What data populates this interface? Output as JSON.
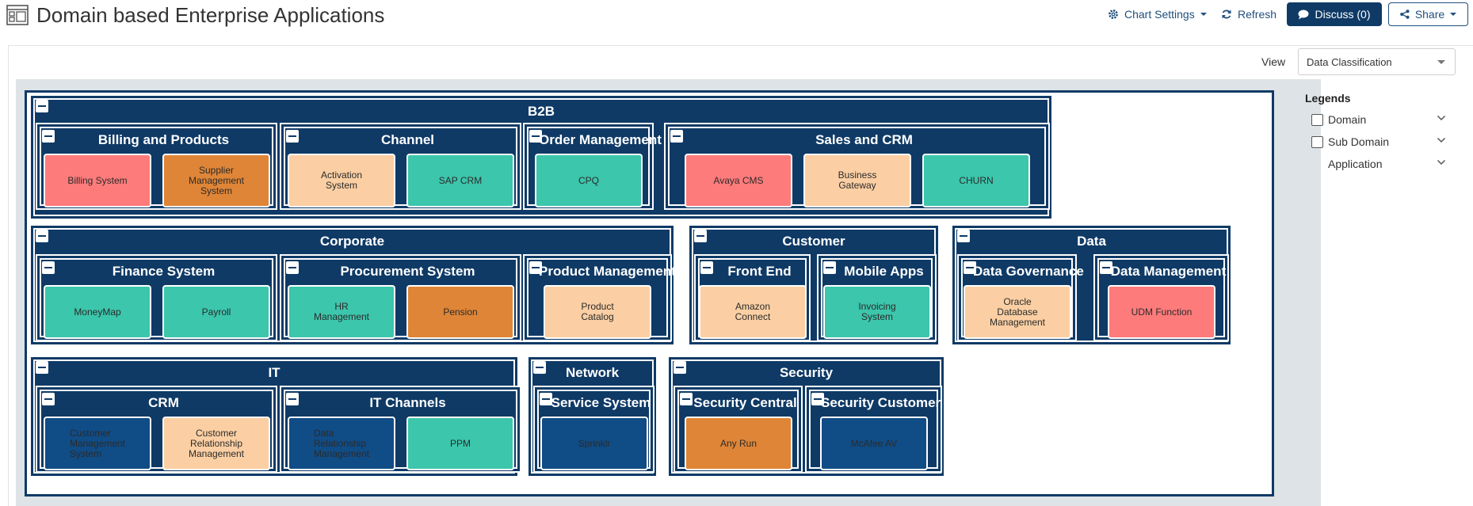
{
  "header": {
    "title": "Domain based Enterprise Applications",
    "chart_settings": "Chart Settings",
    "refresh": "Refresh",
    "discuss": "Discuss (0)",
    "share": "Share"
  },
  "view": {
    "label": "View",
    "selected": "Data Classification"
  },
  "legend": {
    "title": "Legends",
    "items": [
      {
        "label": "Domain",
        "has_checkbox": true
      },
      {
        "label": "Sub Domain",
        "has_checkbox": true
      },
      {
        "label": "Application",
        "has_checkbox": false
      }
    ]
  },
  "colors": {
    "red": "#fe7b7b",
    "orange": "#df8537",
    "peach": "#fbcfa3",
    "teal": "#3cc6ac",
    "navy": "#104c86",
    "frame": "#0f3a66"
  },
  "domains": [
    {
      "name": "B2B",
      "subdomains": [
        {
          "name": "Billing and Products",
          "apps": [
            {
              "name": "Billing System",
              "color": "red"
            },
            {
              "name": "Supplier\nManagement\nSystem",
              "color": "orange"
            }
          ]
        },
        {
          "name": "Channel",
          "apps": [
            {
              "name": "Activation\nSystem",
              "color": "peach"
            },
            {
              "name": "SAP CRM",
              "color": "teal"
            }
          ]
        },
        {
          "name": "Order Management",
          "apps": [
            {
              "name": "CPQ",
              "color": "teal"
            }
          ]
        },
        {
          "name": "Sales and CRM",
          "apps": [
            {
              "name": "Avaya CMS",
              "color": "red"
            },
            {
              "name": "Business\nGateway",
              "color": "peach"
            },
            {
              "name": "CHURN",
              "color": "teal"
            }
          ]
        }
      ]
    },
    {
      "name": "Corporate",
      "subdomains": [
        {
          "name": "Finance System",
          "apps": [
            {
              "name": "MoneyMap",
              "color": "teal"
            },
            {
              "name": "Payroll",
              "color": "teal"
            }
          ]
        },
        {
          "name": "Procurement System",
          "apps": [
            {
              "name": "HR\nManagement",
              "color": "teal"
            },
            {
              "name": "Pension",
              "color": "orange"
            }
          ]
        },
        {
          "name": "Product Management",
          "apps": [
            {
              "name": "Product\nCatalog",
              "color": "peach"
            }
          ]
        }
      ]
    },
    {
      "name": "Customer",
      "subdomains": [
        {
          "name": "Front End",
          "apps": [
            {
              "name": "Amazon\nConnect",
              "color": "peach"
            }
          ]
        },
        {
          "name": "Mobile Apps",
          "apps": [
            {
              "name": "Invoicing\nSystem",
              "color": "teal"
            }
          ]
        }
      ]
    },
    {
      "name": "Data",
      "subdomains": [
        {
          "name": "Data Governance",
          "apps": [
            {
              "name": "Oracle\nDatabase\nManagement",
              "color": "peach"
            }
          ]
        },
        {
          "name": "Data Management",
          "apps": [
            {
              "name": "UDM Function",
              "color": "red"
            }
          ]
        }
      ]
    },
    {
      "name": "IT",
      "subdomains": [
        {
          "name": "CRM",
          "apps": [
            {
              "name": "Customer\nManagement\nSystem",
              "color": "navy"
            },
            {
              "name": "Customer\nRelationship\nManagement",
              "color": "peach"
            }
          ]
        },
        {
          "name": "IT Channels",
          "apps": [
            {
              "name": "Data\nRelationship\nManagement",
              "color": "navy"
            },
            {
              "name": "PPM",
              "color": "teal"
            }
          ]
        }
      ]
    },
    {
      "name": "Network",
      "subdomains": [
        {
          "name": "Service System",
          "apps": [
            {
              "name": "Sprinklr",
              "color": "navy"
            }
          ]
        }
      ]
    },
    {
      "name": "Security",
      "subdomains": [
        {
          "name": "Security Central",
          "apps": [
            {
              "name": "Any Run",
              "color": "orange"
            }
          ]
        },
        {
          "name": "Security Customer",
          "apps": [
            {
              "name": "McAfee AV",
              "color": "navy"
            }
          ]
        }
      ]
    }
  ]
}
